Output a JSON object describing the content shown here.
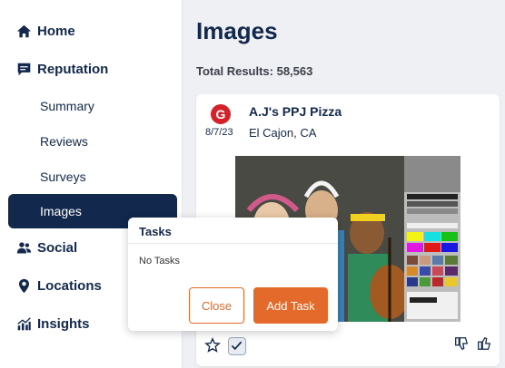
{
  "sidebar": {
    "home": "Home",
    "reputation": "Reputation",
    "summary": "Summary",
    "reviews": "Reviews",
    "surveys": "Surveys",
    "images": "Images",
    "social": "Social",
    "locations": "Locations",
    "insights": "Insights"
  },
  "main": {
    "title": "Images",
    "total_results": "Total Results: 58,563"
  },
  "card": {
    "source_icon": "google-icon",
    "source_letter": "G",
    "date": "8/7/23",
    "name": "A.J's PPJ Pizza",
    "location": "El Cajon, CA"
  },
  "popup": {
    "title": "Tasks",
    "empty_text": "No Tasks",
    "close_label": "Close",
    "add_label": "Add Task"
  },
  "colors": {
    "navy": "#12284c",
    "accent": "#e36a2b",
    "google_red": "#d3222a"
  }
}
